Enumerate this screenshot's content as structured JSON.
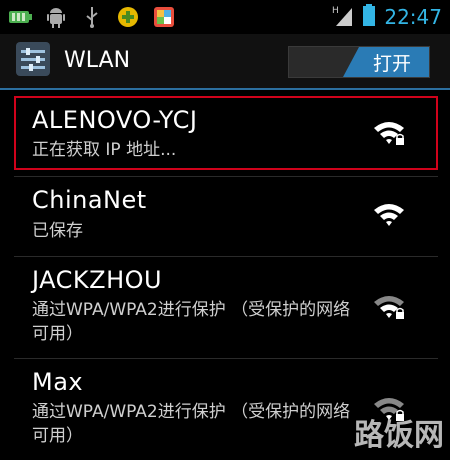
{
  "statusbar": {
    "clock": "22:47",
    "icons": [
      "battery-icon",
      "android-icon",
      "usb-icon",
      "game-icon",
      "store-icon",
      "signal-icon",
      "battery-full-icon"
    ]
  },
  "actionbar": {
    "title": "WLAN",
    "toggle_label": "打开"
  },
  "networks": [
    {
      "ssid": "ALENOVO-YCJ",
      "status": "正在获取 IP 地址...",
      "secured": true
    },
    {
      "ssid": "ChinaNet",
      "status": "已保存",
      "secured": false
    },
    {
      "ssid": "JACKZHOU",
      "status": "通过WPA/WPA2进行保护 （受保护的网络可用）",
      "secured": true
    },
    {
      "ssid": "Max",
      "status": "通过WPA/WPA2进行保护 （受保护的网络可用）",
      "secured": true
    }
  ],
  "watermark": "路饭网",
  "colors": {
    "accent": "#33b5e5",
    "toggle_on": "#2a7bb5",
    "highlight": "#d0021b"
  }
}
